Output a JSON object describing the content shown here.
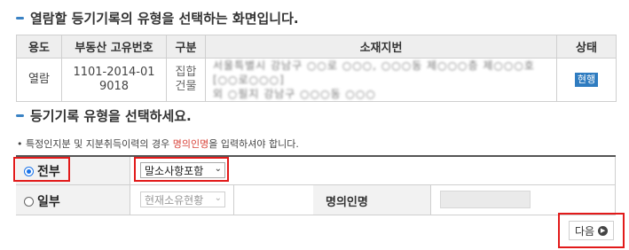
{
  "headings": {
    "main": "열람할 등기기록의 유형을 선택하는 화면입니다.",
    "select": "등기기록 유형을 선택하세요."
  },
  "table": {
    "headers": [
      "용도",
      "부동산 고유번호",
      "구분",
      "소재지번",
      "상태"
    ],
    "row": {
      "purpose": "열람",
      "unique_no_line1": "1101-2014-01",
      "unique_no_line2": "9018",
      "type_line1": "집합",
      "type_line2": "건물",
      "address_line1": "서울특별시 강남구 ○○로 ○○○, ○○○동 제○○○층 제○○○호 [○○로○○○]",
      "address_line2": "외 ○필지 강남구 ○○○동 ○○○",
      "status": "현행"
    }
  },
  "note": {
    "prefix": "• 특정인지분 및 지분취득이력의 경우 ",
    "highlight": "명의인명",
    "suffix": "을 입력하셔야 합니다."
  },
  "options": {
    "all_label": "전부",
    "all_select_value": "말소사항포함",
    "partial_label": "일부",
    "partial_select_value": "현재소유현황",
    "owner_name_label": "명의인명",
    "owner_name_value": ""
  },
  "buttons": {
    "next_label": "다음",
    "next_icon": "circle-arrow-right"
  },
  "colors": {
    "accent": "#3a82c4",
    "highlight_outline": "#e21a1a",
    "status_badge": "#2f7cc0",
    "note_highlight": "#d9453b"
  }
}
